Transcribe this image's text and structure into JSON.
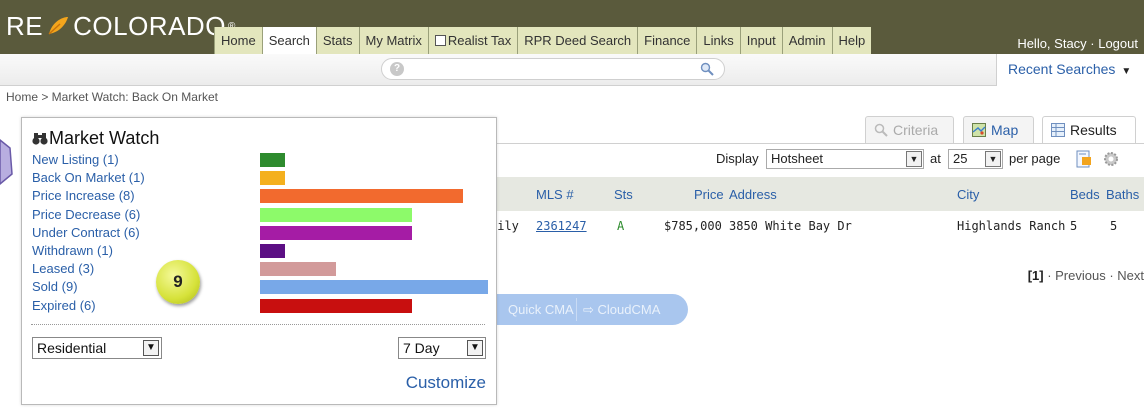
{
  "header": {
    "logo_left": "RE",
    "logo_right": "COLORADO",
    "logo_reg": "®",
    "greeting": "Hello, Stacy · Logout"
  },
  "nav": [
    {
      "label": "Home"
    },
    {
      "label": "Search",
      "active": true
    },
    {
      "label": "Stats"
    },
    {
      "label": "My Matrix"
    },
    {
      "label": "Realist Tax",
      "icon": "window-icon"
    },
    {
      "label": "RPR Deed Search"
    },
    {
      "label": "Finance"
    },
    {
      "label": "Links"
    },
    {
      "label": "Input"
    },
    {
      "label": "Admin"
    },
    {
      "label": "Help"
    }
  ],
  "search": {
    "help_glyph": "?",
    "recent_label": "Recent Searches"
  },
  "breadcrumb": "Home > Market Watch: Back On Market",
  "result_tabs": {
    "criteria": "Criteria",
    "map": "Map",
    "results": "Results"
  },
  "display": {
    "label": "Display",
    "format": "Hotsheet",
    "at_label": "at",
    "per_page": "25",
    "per_page_label": "per page"
  },
  "table": {
    "columns": [
      "MLS #",
      "Sts",
      "Price",
      "Address",
      "City",
      "Beds",
      "Baths"
    ],
    "rows": [
      {
        "type_fragment": "mily",
        "mls": "2361247",
        "status": "A",
        "price": "$785,000",
        "address": "3850 White Bay Dr",
        "city": "Highlands Ranch",
        "beds": "5",
        "baths": "5"
      }
    ]
  },
  "pager": {
    "current": "[1]",
    "rest": " · Previous · Next"
  },
  "cma": {
    "quick": "Quick CMA",
    "cloud": "CloudCMA"
  },
  "market_watch": {
    "title": "Market Watch",
    "items": [
      {
        "label": "New Listing (1)",
        "count": 1,
        "color": "#2e8b2e"
      },
      {
        "label": "Back On Market (1)",
        "count": 1,
        "color": "#f4b01e"
      },
      {
        "label": "Price Increase (8)",
        "count": 8,
        "color": "#f26a2e"
      },
      {
        "label": "Price Decrease (6)",
        "count": 6,
        "color": "#8dfa6a"
      },
      {
        "label": "Under Contract (6)",
        "count": 6,
        "color": "#a51ca5"
      },
      {
        "label": "Withdrawn (1)",
        "count": 1,
        "color": "#5c0f84"
      },
      {
        "label": "Leased (3)",
        "count": 3,
        "color": "#d29a9a"
      },
      {
        "label": "Sold (9)",
        "count": 9,
        "color": "#78a8e8"
      },
      {
        "label": "Expired (6)",
        "count": 6,
        "color": "#c80f0f"
      }
    ],
    "property_type": "Residential",
    "period": "7 Day",
    "customize_label": "Customize"
  },
  "badge": "9"
}
